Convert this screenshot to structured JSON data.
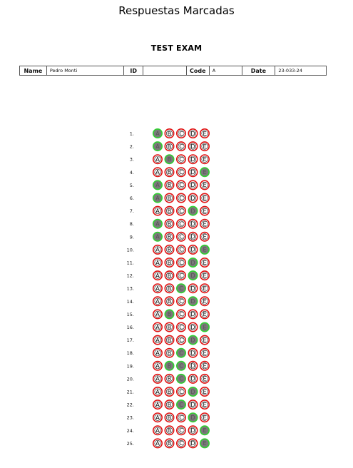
{
  "page_title": "Respuestas Marcadas",
  "exam_title": "TEST EXAM",
  "info": {
    "name_label": "Name",
    "name_value": "Pedro Monti",
    "id_label": "ID",
    "id_value": "",
    "code_label": "Code",
    "code_value": "A",
    "date_label": "Date",
    "date_value": "23-033-24"
  },
  "options": [
    "A",
    "B",
    "C",
    "D",
    "E"
  ],
  "questions": [
    {
      "number": "1.",
      "marked": "A"
    },
    {
      "number": "2.",
      "marked": "A"
    },
    {
      "number": "3.",
      "marked": "B"
    },
    {
      "number": "4.",
      "marked": "E"
    },
    {
      "number": "5.",
      "marked": "A"
    },
    {
      "number": "6.",
      "marked": "A"
    },
    {
      "number": "7.",
      "marked": "D"
    },
    {
      "number": "8.",
      "marked": "A"
    },
    {
      "number": "9.",
      "marked": "A"
    },
    {
      "number": "10.",
      "marked": "E"
    },
    {
      "number": "11.",
      "marked": "D"
    },
    {
      "number": "12.",
      "marked": "D"
    },
    {
      "number": "13.",
      "marked": "C"
    },
    {
      "number": "14.",
      "marked": "D"
    },
    {
      "number": "15.",
      "marked": "B"
    },
    {
      "number": "16.",
      "marked": "E"
    },
    {
      "number": "17.",
      "marked": "D"
    },
    {
      "number": "18.",
      "marked": "C"
    },
    {
      "number": "19.",
      "marked": "B,C"
    },
    {
      "number": "20.",
      "marked": "C"
    },
    {
      "number": "21.",
      "marked": "D"
    },
    {
      "number": "22.",
      "marked": "C"
    },
    {
      "number": "23.",
      "marked": "D"
    },
    {
      "number": "24.",
      "marked": "E"
    },
    {
      "number": "25.",
      "marked": "E"
    }
  ],
  "colors": {
    "ring_default": "#e01010",
    "ring_marked": "#2fd22f",
    "fill_marked": "#7a7a7a",
    "ring_unmarked_black": "#111111",
    "label_correct": "#22cc22",
    "label_wrong": "#ee3333"
  }
}
